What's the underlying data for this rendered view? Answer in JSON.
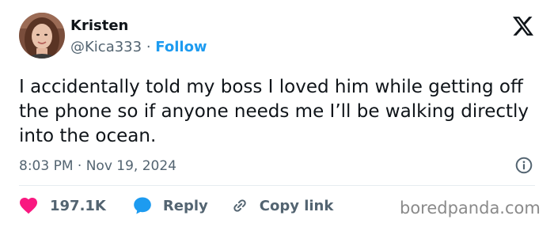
{
  "tweet": {
    "author_name": "Kristen",
    "handle": "@Kica333",
    "separator": "·",
    "follow_label": "Follow",
    "text": "I accidentally told my boss I loved him while getting off the phone so if anyone needs me I’ll be walking directly into the ocean.",
    "timestamp": "8:03 PM · Nov 19, 2024"
  },
  "actions": {
    "likes_count": "197.1K",
    "reply_label": "Reply",
    "copy_link_label": "Copy link"
  },
  "watermark": "boredpanda.com",
  "colors": {
    "accent": "#1d9bf0",
    "like": "#f91880",
    "text": "#0f1419",
    "muted": "#536471",
    "divider": "#e6ecf0"
  },
  "icons": {
    "platform": "x-logo-icon",
    "info": "info-icon",
    "like": "heart-icon",
    "reply": "speech-bubble-icon",
    "copy_link": "link-icon"
  }
}
